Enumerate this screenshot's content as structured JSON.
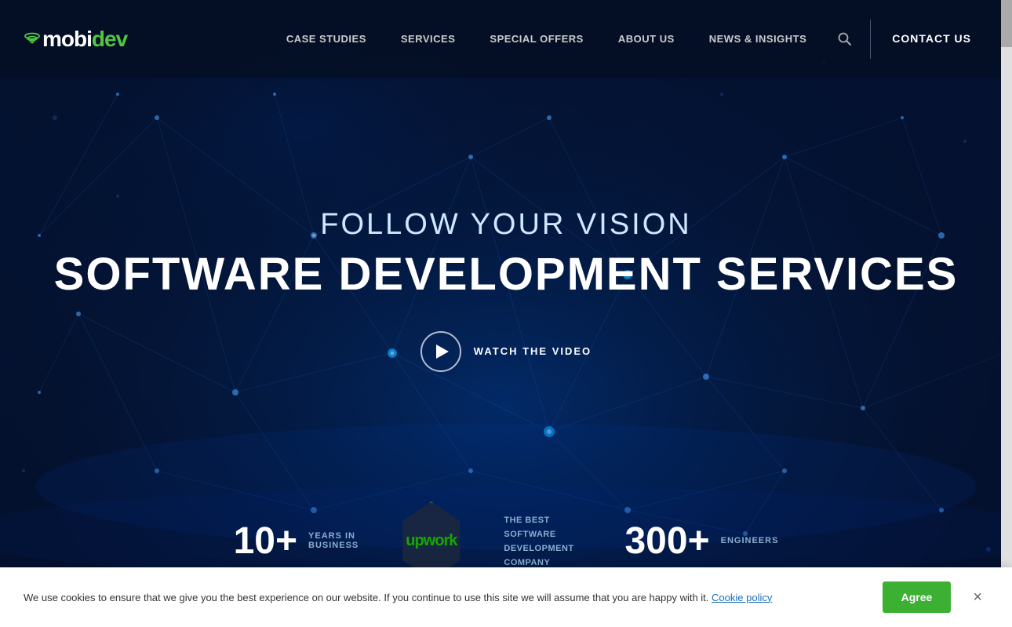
{
  "brand": {
    "name_mobi": "mobi",
    "name_dev": "dev",
    "logo_alt": "MobiDev Logo"
  },
  "nav": {
    "links": [
      {
        "id": "case-studies",
        "label": "CASE STUDIES"
      },
      {
        "id": "services",
        "label": "SERVICES"
      },
      {
        "id": "special-offers",
        "label": "SPECIAL OFFERS"
      },
      {
        "id": "about-us",
        "label": "ABOUT US"
      },
      {
        "id": "news-insights",
        "label": "NEWS & INSIGHTS"
      }
    ],
    "contact_label": "CONTACT US",
    "search_icon": "🔍"
  },
  "hero": {
    "subtitle": "FOLLOW YOUR VISION",
    "title": "SOFTWARE DEVELOPMENT SERVICES",
    "video_button_label": "WATCH THE VIDEO"
  },
  "stats": [
    {
      "number": "10+",
      "label": "YEARS IN BUSINESS"
    },
    {
      "badge_name": "upwork",
      "badge_text": "upwork",
      "badge_desc": "THE BEST SOFTWARE DEVELOPMENT COMPANY"
    },
    {
      "number": "300+",
      "label": "ENGINEERS"
    }
  ],
  "cookie": {
    "text": "We use cookies to ensure that we give you the best experience on our website. If you continue to use this site we will assume that you are happy with it.",
    "link_text": "Cookie policy",
    "agree_label": "Agree",
    "close_label": "×"
  }
}
